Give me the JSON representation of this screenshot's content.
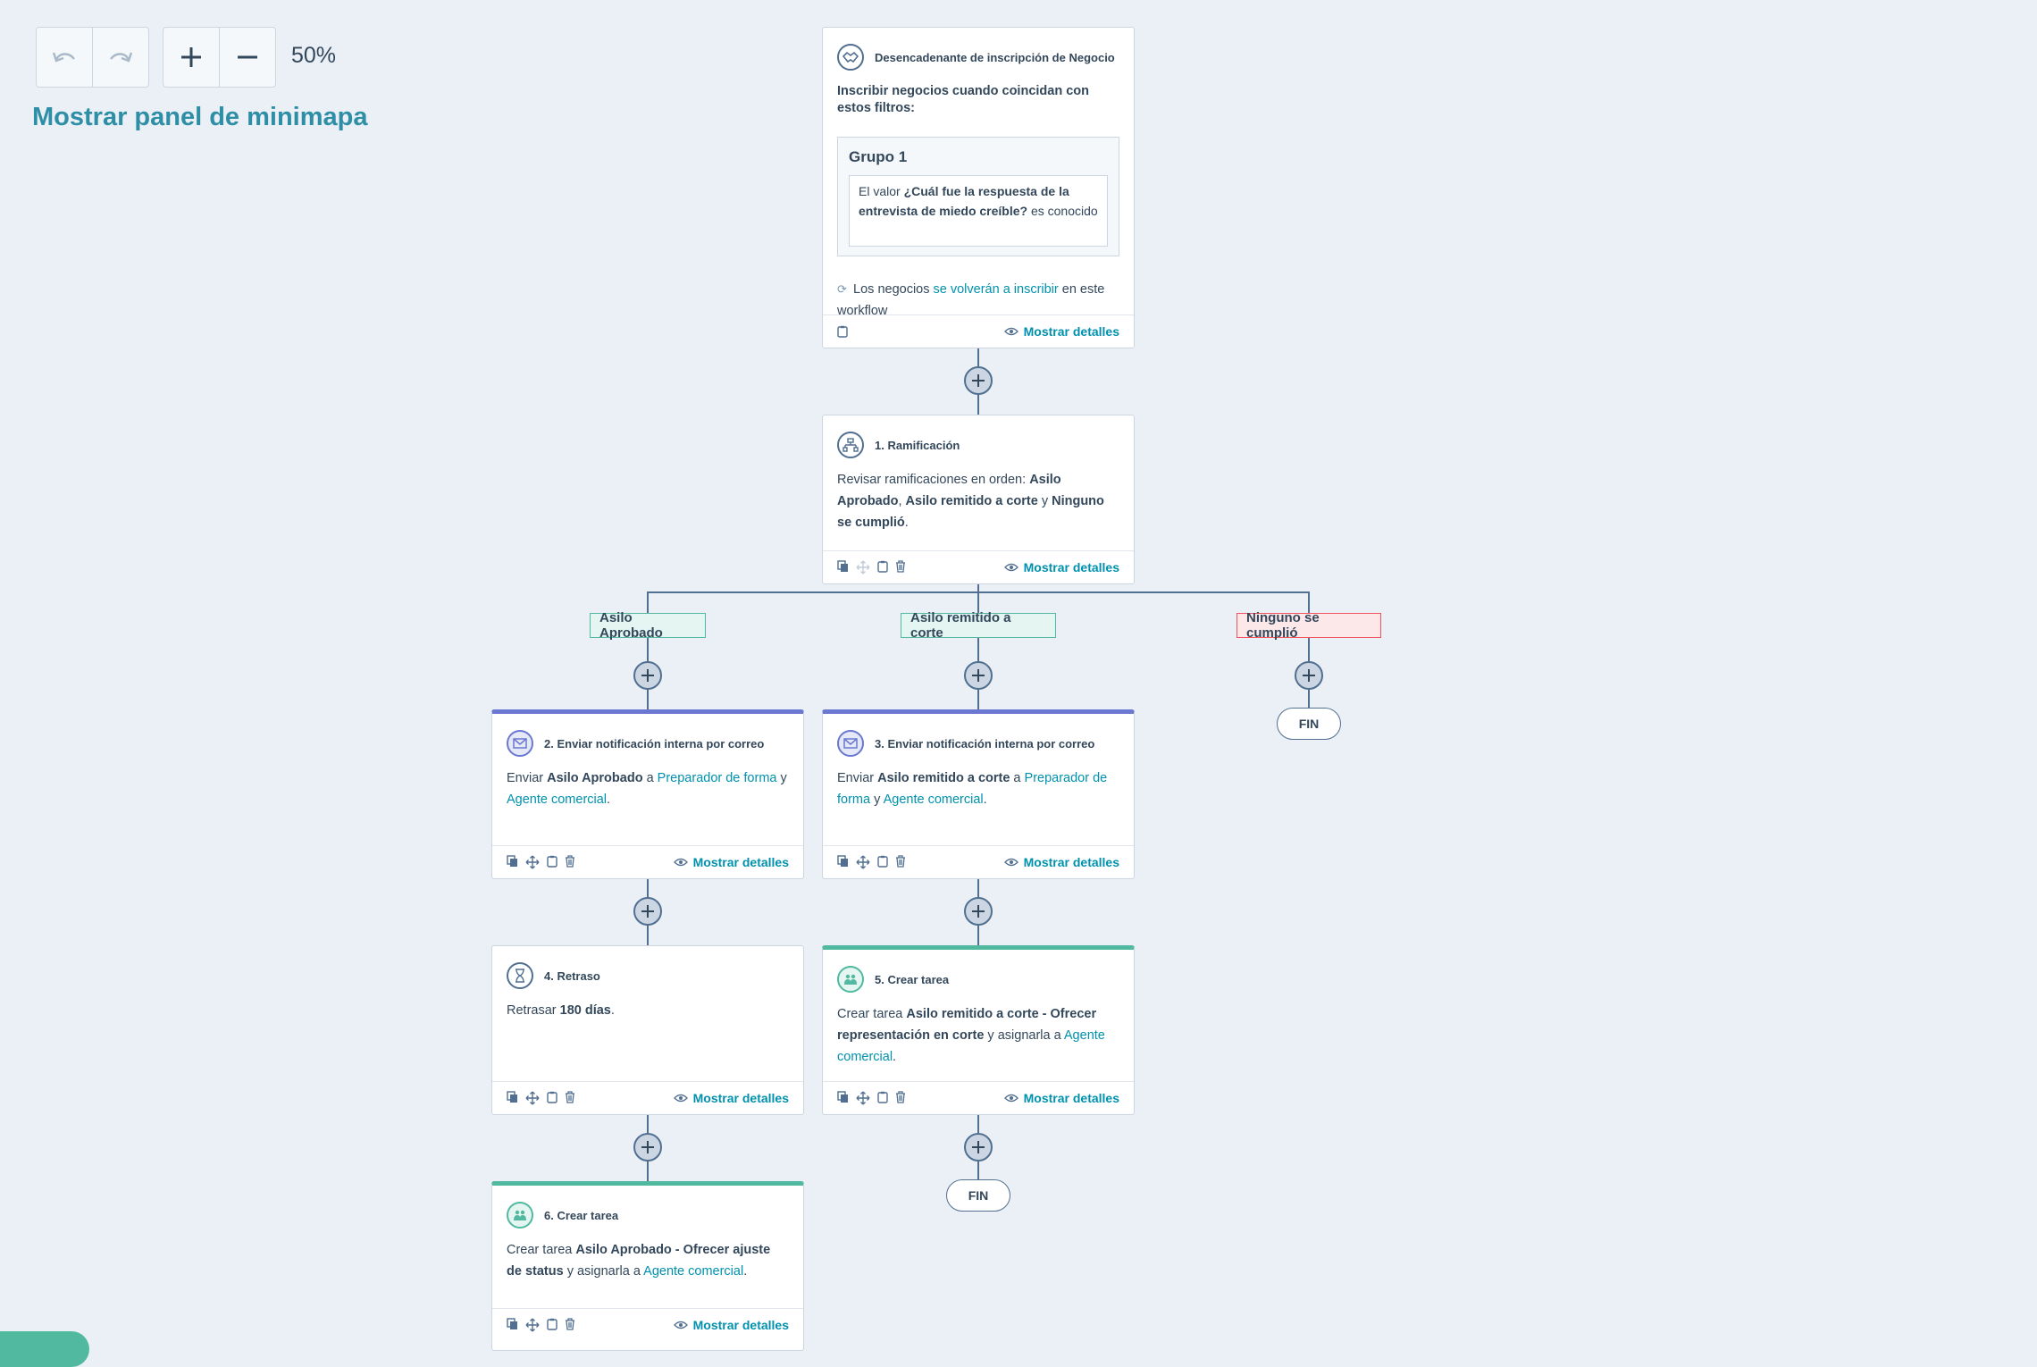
{
  "toolbar": {
    "zoom": "50%",
    "minimap_label": "Mostrar panel de minimapa"
  },
  "trigger": {
    "title": "Desencadenante de inscripción de Negocio",
    "subtitle": "Inscribir negocios cuando coincidan con estos filtros:",
    "group_title": "Grupo 1",
    "filter_prefix": "El valor ",
    "filter_property": "¿Cuál fue la respuesta de la entrevista de miedo creíble?",
    "filter_suffix": " es conocido",
    "reenroll_prefix": "Los negocios ",
    "reenroll_link": "se volverán a inscribir",
    "reenroll_suffix": " en este workflow"
  },
  "details_label": "Mostrar detalles",
  "branch": {
    "title": "1. Ramificación",
    "text_prefix": "Revisar ramificaciones en orden: ",
    "b1": "Asilo Aprobado",
    "sep1": ", ",
    "b2": "Asilo remitido a corte",
    "sep2": " y ",
    "b3": "Ninguno se cumplió",
    "end": "."
  },
  "branch_labels": {
    "approved": "Asilo Aprobado",
    "court": "Asilo remitido a corte",
    "none": "Ninguno se cumplió"
  },
  "end_label": "FIN",
  "step2": {
    "title": "2. Enviar notificación interna por correo",
    "w_send": "Enviar ",
    "subject": "Asilo Aprobado",
    "w_to": " a ",
    "r1": "Preparador de forma",
    "w_and": " y ",
    "r2": "Agente comercial",
    "end": "."
  },
  "step3": {
    "title": "3. Enviar notificación interna por correo",
    "w_send": "Enviar ",
    "subject": "Asilo remitido a corte",
    "w_to": " a ",
    "r1": "Preparador de forma",
    "w_and": " y ",
    "r2": "Agente comercial",
    "end": "."
  },
  "step4": {
    "title": "4. Retraso",
    "w_delay": "Retrasar ",
    "duration": "180 días",
    "end": "."
  },
  "step5": {
    "title": "5. Crear tarea",
    "w_create": "Crear tarea ",
    "task": "Asilo remitido a corte - Ofrecer representación en corte",
    "w_assign": " y asignarla a ",
    "assignee": "Agente comercial",
    "end": "."
  },
  "step6": {
    "title": "6. Crear tarea",
    "w_create": "Crear tarea ",
    "task": "Asilo Aprobado - Ofrecer ajuste de status",
    "w_assign": " y asignarla a ",
    "assignee": "Agente comercial",
    "end": "."
  }
}
